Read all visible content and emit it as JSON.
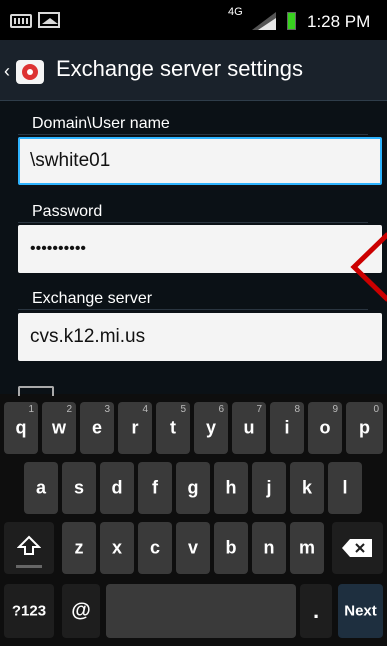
{
  "status_bar": {
    "network": "4G",
    "time": "1:28 PM",
    "icons": [
      "keyboard-icon",
      "picture-icon",
      "signal-icon",
      "battery-icon"
    ]
  },
  "header": {
    "title": "Exchange server settings",
    "icon": "exchange-app-icon"
  },
  "form": {
    "domain_label": "Domain\\User name",
    "domain_value": "\\swhite01",
    "password_label": "Password",
    "password_value": "••••••••••",
    "server_label": "Exchange server",
    "server_value": "cvs.k12.mi.us"
  },
  "keyboard": {
    "row1": [
      {
        "key": "q",
        "num": "1"
      },
      {
        "key": "w",
        "num": "2"
      },
      {
        "key": "e",
        "num": "3"
      },
      {
        "key": "r",
        "num": "4"
      },
      {
        "key": "t",
        "num": "5"
      },
      {
        "key": "y",
        "num": "6"
      },
      {
        "key": "u",
        "num": "7"
      },
      {
        "key": "i",
        "num": "8"
      },
      {
        "key": "o",
        "num": "9"
      },
      {
        "key": "p",
        "num": "0"
      }
    ],
    "row2": [
      "a",
      "s",
      "d",
      "f",
      "g",
      "h",
      "j",
      "k",
      "l"
    ],
    "row3": [
      "z",
      "x",
      "c",
      "v",
      "b",
      "n",
      "m"
    ],
    "symbols_label": "?123",
    "at_label": "@",
    "period_label": ".",
    "next_label": "Next"
  },
  "colors": {
    "accent": "#2fb4ff",
    "header_bg": "#1a222b",
    "battery": "#38d11f",
    "annotation": "#cc0000"
  }
}
